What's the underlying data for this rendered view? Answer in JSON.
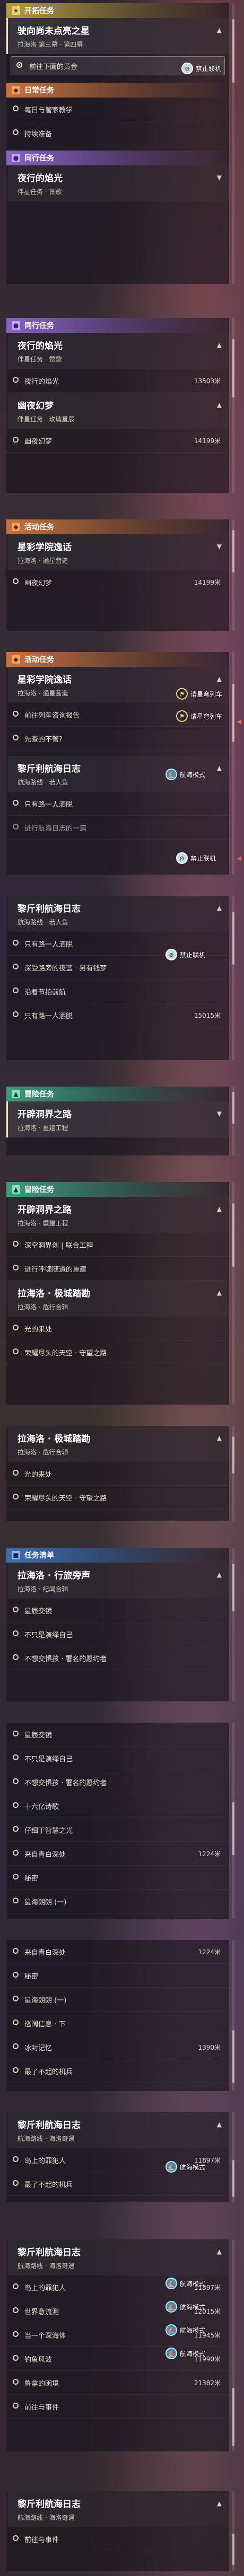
{
  "missions": {
    "trailblaze": {
      "header": "开拓任务"
    },
    "daily": {
      "header": "日常任务"
    },
    "companion": {
      "header": "同行任务"
    },
    "event": {
      "header": "活动任务"
    },
    "adventure": {
      "header": "冒险任务"
    },
    "mission_list": {
      "header": "任务清单"
    }
  },
  "labels": {
    "online_badge": "航海模式",
    "block_badge": "禁止联机",
    "track_badge": "请星穹列车"
  },
  "sections": [
    {
      "header": "开拓任务",
      "color": "gold",
      "icon": "★",
      "mission": {
        "title": "驶向尚未点亮之星",
        "sub": "拉海洛 第三幕 · 第四幕",
        "selected": true
      },
      "steps": [
        {
          "text": "前往下面的黄金",
          "active": true
        }
      ]
    },
    {
      "header": "日常任务",
      "color": "orange",
      "icon": "◆",
      "steps": [
        {
          "text": "每日与管家教学"
        },
        {
          "text": "持续准备"
        }
      ]
    },
    {
      "header": "同行任务",
      "color": "purple",
      "icon": "●",
      "mission": {
        "title": "夜行的焰光",
        "sub": "伴星任务 · 赞歌"
      },
      "steps": []
    },
    {
      "header": "同行任务",
      "color": "purple",
      "icon": "●",
      "mission": {
        "title": "夜行的焰光",
        "sub": "伴星任务 · 赞歌"
      },
      "steps": [
        {
          "text": "夜行的焰光",
          "dist": "13503米"
        }
      ]
    },
    {
      "mission": {
        "title": "幽夜幻梦",
        "sub": "伴星任务 · 玫瑰星辰"
      },
      "steps": [
        {
          "text": "幽夜幻梦",
          "dist": "14199米"
        }
      ]
    },
    {
      "header": "活动任务",
      "color": "orange",
      "icon": "◆",
      "mission": {
        "title": "星彩学院逸话",
        "sub": "拉海洛 · 通星营造"
      },
      "steps": [
        {
          "text": "幽夜幻梦",
          "dist": "14199米"
        }
      ]
    },
    {
      "header": "活动任务",
      "color": "orange",
      "icon": "◆",
      "mission": {
        "title": "星彩学院逸话",
        "sub": "拉海洛 · 通星营造"
      },
      "steps": [
        {
          "text": "前往列车咨询报告"
        },
        {
          "text": "先查的不管?"
        }
      ]
    },
    {
      "mission": {
        "title": "黎斤利航海日志",
        "sub": "航海路线 · 若人鱼"
      },
      "steps": [
        {
          "text": "只有路一人洒脱"
        },
        {
          "text": "进行航海日志的一篇"
        }
      ]
    },
    {
      "mission": {
        "title": "黎斤利航海日志",
        "sub": "航海路线 · 若人鱼"
      },
      "steps": [
        {
          "text": "只有路一人洒脱"
        },
        {
          "text": "深受路旁的夜蓝 · 另有钱梦"
        },
        {
          "text": "沿着节拍前航"
        },
        {
          "text": "只有路一人洒脱",
          "dist": "15015米"
        }
      ]
    },
    {
      "header": "冒险任务",
      "color": "green",
      "icon": "▲",
      "mission": {
        "title": "开辟洞界之路",
        "sub": "拉海洛 · 重建工程"
      },
      "steps": []
    },
    {
      "header": "冒险任务",
      "color": "green",
      "icon": "▲",
      "mission": {
        "title": "开辟洞界之路",
        "sub": "拉海洛 · 重建工程"
      },
      "steps": [
        {
          "text": "深空洞界创 | 联合工程"
        },
        {
          "text": "进行呼啸随道的重建"
        }
      ]
    },
    {
      "mission": {
        "title": "拉海洛 · 极城踏勘",
        "sub": "拉海洛 · 危行合辑"
      },
      "steps": [
        {
          "text": "光的来处"
        },
        {
          "text": "荣耀尽头的天空 · 守望之路"
        }
      ]
    },
    {
      "mission": {
        "title": "拉海洛 · 极城踏勘",
        "sub": "拉海洛 · 危行合辑"
      },
      "steps": [
        {
          "text": "光的来处"
        },
        {
          "text": "荣耀尽头的天空 · 守望之路"
        }
      ]
    },
    {
      "header": "任务清单",
      "color": "blue",
      "icon": "■",
      "mission": {
        "title": "拉海洛 · 行旅旁声",
        "sub": "拉海洛 · 纪闻合辑"
      },
      "steps": [
        {
          "text": "星辰交镜"
        },
        {
          "text": "不只是演绎自己"
        },
        {
          "text": "不想交惧孩 · 署名的愿约者"
        }
      ]
    },
    {
      "steps": [
        {
          "text": "星辰交镜"
        },
        {
          "text": "不只是演绎自己"
        },
        {
          "text": "不想交惧孩 · 署名的愿约者"
        },
        {
          "text": "十六亿诗歌"
        },
        {
          "text": "仔细于智慧之光"
        },
        {
          "text": "来自青白深处",
          "dist": "1224米"
        },
        {
          "text": "秘密"
        },
        {
          "text": "星海朗朗 (一)"
        }
      ]
    },
    {
      "steps": [
        {
          "text": "来自青白深处",
          "dist": "1224米"
        },
        {
          "text": "秘密"
        },
        {
          "text": "星海朗朗 (一)"
        },
        {
          "text": "巡阔信息 · 下"
        },
        {
          "text": "冰封记忆",
          "dist": "1390米"
        },
        {
          "text": "最了不起的机兵"
        }
      ]
    },
    {
      "mission": {
        "title": "黎斤利航海日志",
        "sub": "航海路线 · 海洛奇遇"
      },
      "steps": [
        {
          "text": "岛上的罪犯人",
          "dist": "11897米"
        },
        {
          "text": "最了不起的机兵"
        }
      ]
    },
    {
      "mission": {
        "title": "黎斤利航海日志",
        "sub": "航海路线 · 海洛奇遇"
      },
      "steps": [
        {
          "text": "岛上的罪犯人",
          "dist": "11897米"
        },
        {
          "text": "世界意流测",
          "dist": "12015米"
        },
        {
          "text": "当一个深海体",
          "dist": "11945米"
        },
        {
          "text": "钓鱼风波",
          "dist": "11990米"
        },
        {
          "text": "鲁拿的困境",
          "dist": "21382米"
        },
        {
          "text": "前往与事件"
        }
      ]
    }
  ]
}
